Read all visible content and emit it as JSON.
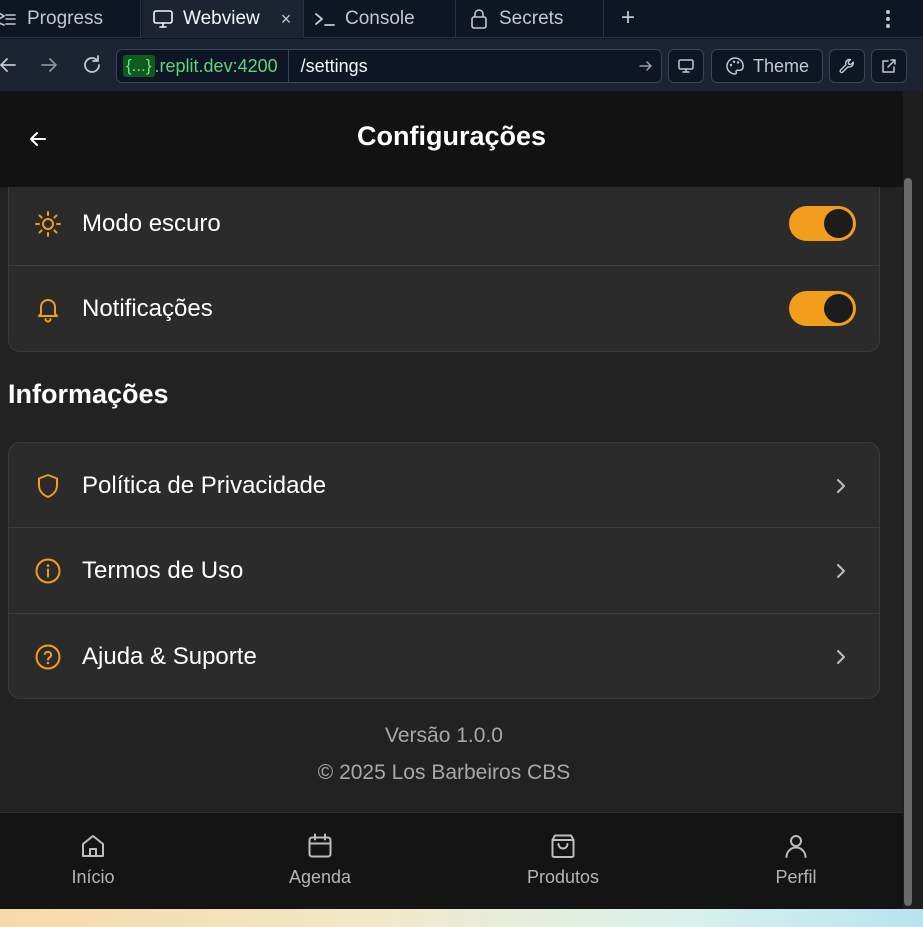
{
  "colors": {
    "accent": "#f29d1b",
    "app_background": "#222222",
    "card_background": "#2b2b2b",
    "header_background": "#121212",
    "ide_background": "#0e1525",
    "url_host": "#5bd77a"
  },
  "ide": {
    "tabs": [
      {
        "label": "Progress",
        "icon": "progress-icon",
        "active": false
      },
      {
        "label": "Webview",
        "icon": "monitor-icon",
        "active": true,
        "close": "×"
      },
      {
        "label": "Console",
        "icon": "terminal-icon",
        "active": false
      },
      {
        "label": "Secrets",
        "icon": "lock-icon",
        "active": false
      }
    ],
    "add_tab": "+",
    "url_badge": "{...}",
    "url_host": ".replit.dev:4200",
    "url_path": "/settings",
    "theme_label": "Theme"
  },
  "app": {
    "title": "Configurações",
    "settings_rows": [
      {
        "label": "Modo escuro",
        "icon": "sun-icon",
        "enabled": true
      },
      {
        "label": "Notificações",
        "icon": "bell-icon",
        "enabled": true
      }
    ],
    "info_section_title": "Informações",
    "info_rows": [
      {
        "label": "Política de Privacidade",
        "icon": "shield-icon"
      },
      {
        "label": "Termos de Uso",
        "icon": "info-circle-icon"
      },
      {
        "label": "Ajuda & Suporte",
        "icon": "help-circle-icon"
      }
    ],
    "version": "Versão 1.0.0",
    "copyright": "© 2025 Los Barbeiros CBS",
    "bottom_nav": [
      {
        "label": "Início",
        "icon": "home-icon"
      },
      {
        "label": "Agenda",
        "icon": "calendar-icon"
      },
      {
        "label": "Produtos",
        "icon": "shopping-bag-icon"
      },
      {
        "label": "Perfil",
        "icon": "user-icon"
      }
    ]
  }
}
